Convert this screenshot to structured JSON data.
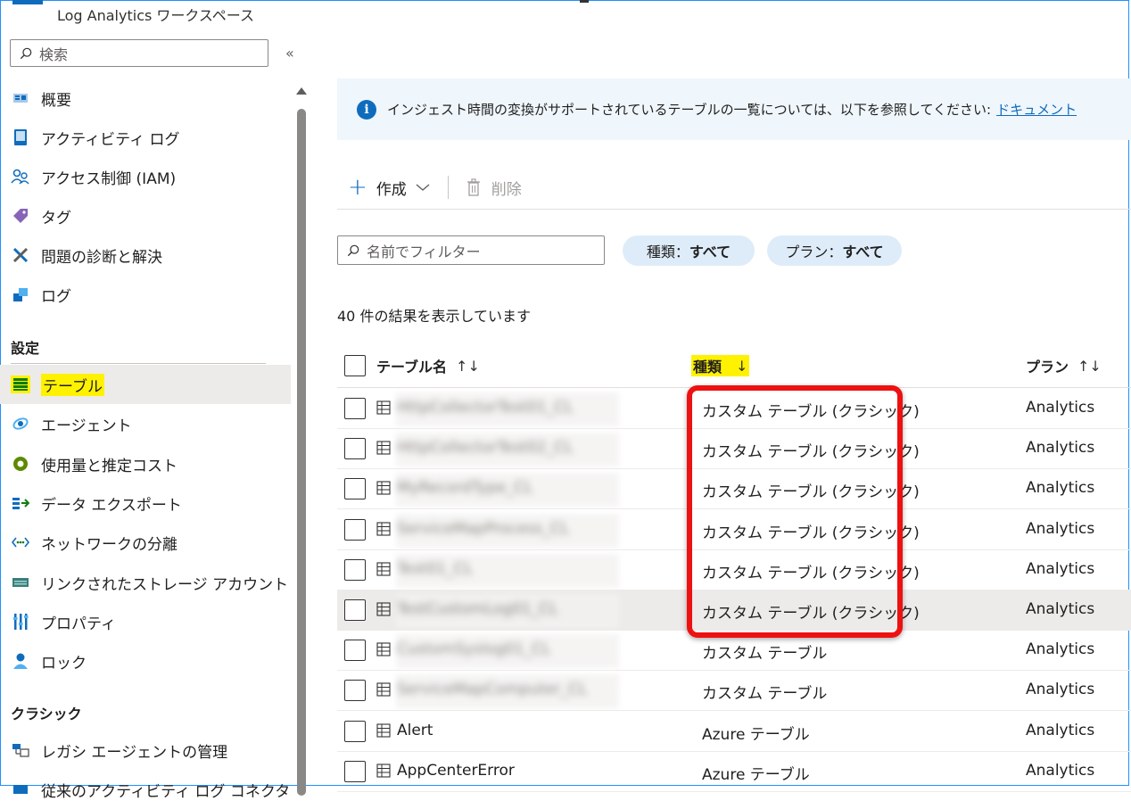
{
  "workspace": {
    "subtitle": "Log Analytics ワークスペース"
  },
  "sidebar": {
    "search_placeholder": "検索",
    "collapse_glyph": "«",
    "items_top": [
      {
        "label": "概要",
        "icon": "overview-icon"
      },
      {
        "label": "アクティビティ ログ",
        "icon": "activity-log-icon"
      },
      {
        "label": "アクセス制御 (IAM)",
        "icon": "iam-icon"
      },
      {
        "label": "タグ",
        "icon": "tag-icon"
      },
      {
        "label": "問題の診断と解決",
        "icon": "wrench-icon"
      },
      {
        "label": "ログ",
        "icon": "logs-icon"
      }
    ],
    "section_settings": "設定",
    "items_settings": [
      {
        "label": "テーブル",
        "icon": "table-icon",
        "selected": true
      },
      {
        "label": "エージェント",
        "icon": "agent-icon"
      },
      {
        "label": "使用量と推定コスト",
        "icon": "usage-icon"
      },
      {
        "label": "データ エクスポート",
        "icon": "export-icon"
      },
      {
        "label": "ネットワークの分離",
        "icon": "network-icon"
      },
      {
        "label": "リンクされたストレージ アカウント",
        "icon": "storage-icon"
      },
      {
        "label": "プロパティ",
        "icon": "properties-icon"
      },
      {
        "label": "ロック",
        "icon": "lock-icon"
      }
    ],
    "section_classic": "クラシック",
    "items_classic": [
      {
        "label": "レガシ エージェントの管理",
        "icon": "legacy-agent-icon"
      },
      {
        "label": "従来のアクティビティ ログ コネクタ",
        "icon": "legacy-connector-icon"
      }
    ]
  },
  "info_bar": {
    "text": "インジェスト時間の変換がサポートされているテーブルの一覧については、以下を参照してください:",
    "link": "ドキュメント"
  },
  "toolbar": {
    "create_label": "作成",
    "delete_label": "削除"
  },
  "filter": {
    "placeholder": "名前でフィルター",
    "type_pill_prefix": "種類：",
    "type_pill_value": "すべて",
    "plan_pill_prefix": "プラン：",
    "plan_pill_value": "すべて"
  },
  "result_count": "40 件の結果を表示しています",
  "table": {
    "col_name": "テーブル名",
    "col_type": "種類",
    "col_plan": "プラン",
    "sort_both": "↑↓",
    "sort_down": "↓",
    "rows": [
      {
        "name": "HttpCollectorTest01_CL",
        "blurred": true,
        "type": "カスタム テーブル (クラシック)",
        "plan": "Analytics"
      },
      {
        "name": "HttpCollectorTest02_CL",
        "blurred": true,
        "type": "カスタム テーブル (クラシック)",
        "plan": "Analytics"
      },
      {
        "name": "MyRecordType_CL",
        "blurred": true,
        "type": "カスタム テーブル (クラシック)",
        "plan": "Analytics"
      },
      {
        "name": "ServiceMapProcess_CL",
        "blurred": true,
        "type": "カスタム テーブル (クラシック)",
        "plan": "Analytics"
      },
      {
        "name": "Test01_CL",
        "blurred": true,
        "type": "カスタム テーブル (クラシック)",
        "plan": "Analytics"
      },
      {
        "name": "TestCustomLog01_CL",
        "blurred": true,
        "type": "カスタム テーブル (クラシック)",
        "plan": "Analytics",
        "hover": true
      },
      {
        "name": "CustomSyslog01_CL",
        "blurred": true,
        "type": "カスタム テーブル",
        "plan": "Analytics"
      },
      {
        "name": "ServiceMapComputer_CL",
        "blurred": true,
        "type": "カスタム テーブル",
        "plan": "Analytics"
      },
      {
        "name": "Alert",
        "blurred": false,
        "type": "Azure テーブル",
        "plan": "Analytics"
      },
      {
        "name": "AppCenterError",
        "blurred": false,
        "type": "Azure テーブル",
        "plan": "Analytics"
      }
    ]
  },
  "colors": {
    "accent": "#0f6cbd",
    "highlight": "#fff200",
    "annotation": "#ee1111",
    "pill": "#deecf9"
  }
}
